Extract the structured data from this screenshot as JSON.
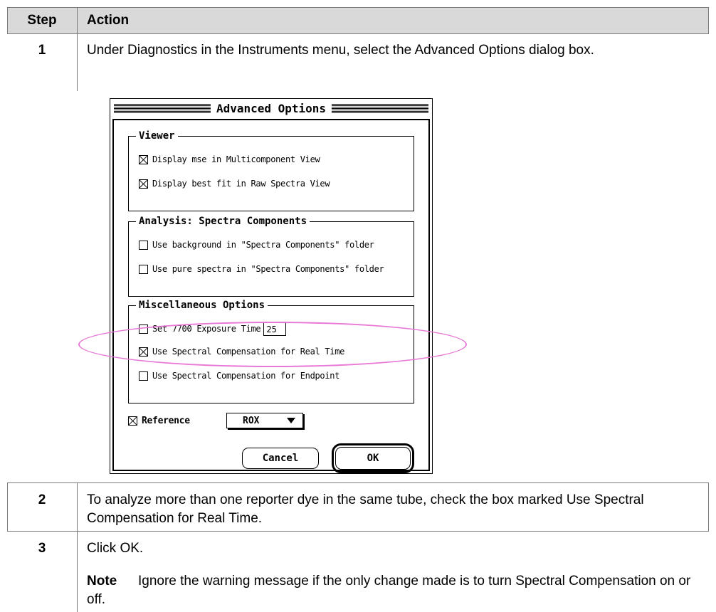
{
  "table": {
    "headers": {
      "step": "Step",
      "action": "Action"
    },
    "rows": [
      {
        "step": "1",
        "text": "Under Diagnostics in the Instruments menu, select the Advanced Options dialog box."
      },
      {
        "step": "2",
        "text": "To analyze more than one reporter dye in the same tube, check the box marked Use Spectral Compensation for Real Time."
      },
      {
        "step": "3",
        "text": "Click OK.",
        "note_label": "Note",
        "note_text": "Ignore the warning message if the only change made is to turn Spectral Compensation on or off."
      }
    ]
  },
  "dialog": {
    "title": "Advanced Options",
    "viewer": {
      "title": "Viewer",
      "options": [
        {
          "label": "Display mse in Multicomponent View",
          "checked": true
        },
        {
          "label": "Display best fit in Raw Spectra View",
          "checked": true
        }
      ]
    },
    "analysis": {
      "title": "Analysis: Spectra Components",
      "options": [
        {
          "label": "Use background in \"Spectra Components\" folder",
          "checked": false
        },
        {
          "label": "Use pure spectra in \"Spectra Components\" folder",
          "checked": false
        }
      ]
    },
    "misc": {
      "title": "Miscellaneous Options",
      "exposure_label": "Set 7700 Exposure Time",
      "exposure_value": "25",
      "exposure_checked": false,
      "realtime_label": "Use Spectral Compensation for Real Time",
      "realtime_checked": true,
      "endpoint_label": "Use Spectral Compensation for Endpoint",
      "endpoint_checked": false
    },
    "reference": {
      "label": "Reference",
      "checked": true,
      "value": "ROX"
    },
    "buttons": {
      "cancel": "Cancel",
      "ok": "OK"
    }
  },
  "colors": {
    "highlight": "#e879d6",
    "header_bg": "#d9d9d9"
  },
  "icons": [
    "checkbox-checked-icon",
    "checkbox-empty-icon",
    "popup-arrow-icon"
  ]
}
